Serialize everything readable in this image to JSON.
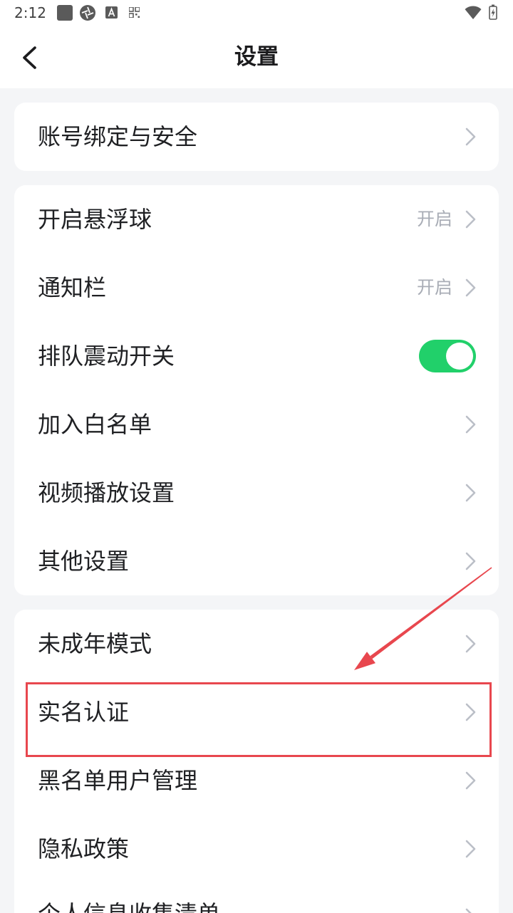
{
  "status_bar": {
    "time": "2:12",
    "left_icons": [
      "app-square-icon",
      "aperture-icon",
      "text-a-icon",
      "qr-code-icon"
    ],
    "right_icons": [
      "wifi-icon",
      "battery-charging-icon"
    ]
  },
  "header": {
    "title": "设置",
    "back_icon": "back-icon"
  },
  "groups": [
    {
      "items": [
        {
          "label": "账号绑定与安全",
          "icon": "chevron-right-icon"
        }
      ]
    },
    {
      "items": [
        {
          "label": "开启悬浮球",
          "value": "开启",
          "icon": "chevron-right-icon"
        },
        {
          "label": "通知栏",
          "value": "开启",
          "icon": "chevron-right-icon"
        },
        {
          "label": "排队震动开关",
          "toggle_on": true
        },
        {
          "label": "加入白名单",
          "icon": "chevron-right-icon"
        },
        {
          "label": "视频播放设置",
          "icon": "chevron-right-icon"
        },
        {
          "label": "其他设置",
          "icon": "chevron-right-icon"
        }
      ]
    },
    {
      "items": [
        {
          "label": "未成年模式",
          "icon": "chevron-right-icon"
        },
        {
          "label": "实名认证",
          "icon": "chevron-right-icon",
          "highlighted": true
        },
        {
          "label": "黑名单用户管理",
          "icon": "chevron-right-icon"
        },
        {
          "label": "隐私政策",
          "icon": "chevron-right-icon"
        },
        {
          "label": "个人信息收集清单",
          "icon": "chevron-right-icon"
        }
      ]
    }
  ],
  "theme": {
    "background": "#F4F5F7",
    "card": "#FFFFFF",
    "text": "#1F2023",
    "secondary_text": "#A9ADB6",
    "chevron": "#BBBFC7",
    "toggle_on": "#21D06A",
    "annotation": "#E8474E"
  }
}
